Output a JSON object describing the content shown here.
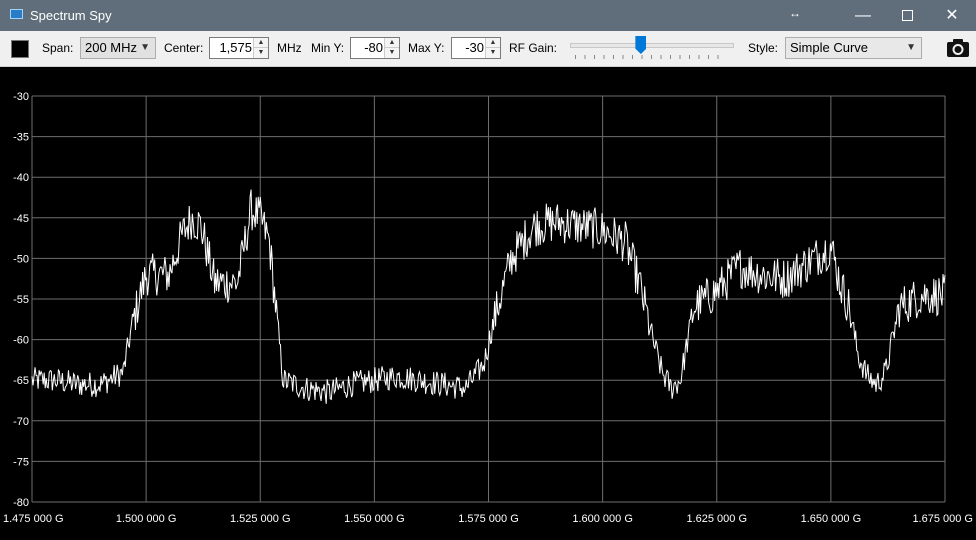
{
  "window": {
    "title": "Spectrum Spy",
    "minimize_glyph": "—",
    "close_glyph": "✕"
  },
  "toolbar": {
    "span_label": "Span:",
    "span_value": "200 MHz",
    "center_label": "Center:",
    "center_value": "1,575",
    "center_unit": "MHz",
    "miny_label": "Min Y:",
    "miny_value": "-80",
    "maxy_label": "Max Y:",
    "maxy_value": "-30",
    "gain_label": "RF Gain:",
    "gain_level": 0.43,
    "style_label": "Style:",
    "style_value": "Simple Curve",
    "color_swatch": "#000000",
    "icons": [
      "app-icon",
      "resize-icon",
      "minimize-icon",
      "maximize-icon",
      "close-icon",
      "color-swatch",
      "camera-icon"
    ]
  },
  "chart_data": {
    "type": "line",
    "background": "#000000",
    "line_color": "#ffffff",
    "grid": true,
    "xlim": [
      1.475,
      1.675
    ],
    "ylim": [
      -80,
      -30
    ],
    "x_ticks": [
      1.475,
      1.5,
      1.525,
      1.55,
      1.575,
      1.6,
      1.625,
      1.65,
      1.675
    ],
    "x_tick_labels": [
      "1.475 000 G",
      "1.500 000 G",
      "1.525 000 G",
      "1.550 000 G",
      "1.575 000 G",
      "1.600 000 G",
      "1.625 000 G",
      "1.650 000 G",
      "1.675 000 G"
    ],
    "y_ticks": [
      -30,
      -35,
      -40,
      -45,
      -50,
      -55,
      -60,
      -65,
      -70,
      -75,
      -80
    ],
    "y_tick_labels": [
      "-30",
      "-35",
      "-40",
      "-45",
      "-50",
      "-55",
      "-60",
      "-65",
      "-70",
      "-75",
      "-80"
    ],
    "series": [
      {
        "x": [
          1.475,
          1.48,
          1.485,
          1.49,
          1.495,
          1.497,
          1.5,
          1.505,
          1.508,
          1.51,
          1.512,
          1.515,
          1.517,
          1.52,
          1.523,
          1.525,
          1.527,
          1.53,
          1.535,
          1.54,
          1.545,
          1.55,
          1.555,
          1.56,
          1.565,
          1.57,
          1.574,
          1.576,
          1.58,
          1.585,
          1.59,
          1.595,
          1.6,
          1.605,
          1.608,
          1.611,
          1.613,
          1.615,
          1.617,
          1.62,
          1.625,
          1.63,
          1.635,
          1.64,
          1.645,
          1.65,
          1.652,
          1.654,
          1.656,
          1.658,
          1.66,
          1.662,
          1.665,
          1.67,
          1.675
        ],
        "y": [
          -65,
          -65,
          -65.5,
          -65.5,
          -64,
          -58,
          -52,
          -52,
          -47,
          -45,
          -46,
          -53,
          -53,
          -53,
          -44,
          -45,
          -48,
          -65,
          -66,
          -66.5,
          -65.5,
          -65,
          -64.5,
          -65,
          -65.5,
          -66,
          -63,
          -58,
          -50,
          -46,
          -45.5,
          -46,
          -46.5,
          -48,
          -53,
          -60,
          -64,
          -66,
          -65,
          -56,
          -54,
          -51,
          -52,
          -52.5,
          -50.5,
          -48.5,
          -53,
          -56,
          -62,
          -64.5,
          -65.5,
          -64,
          -56,
          -54.5,
          -54.5
        ]
      }
    ]
  }
}
